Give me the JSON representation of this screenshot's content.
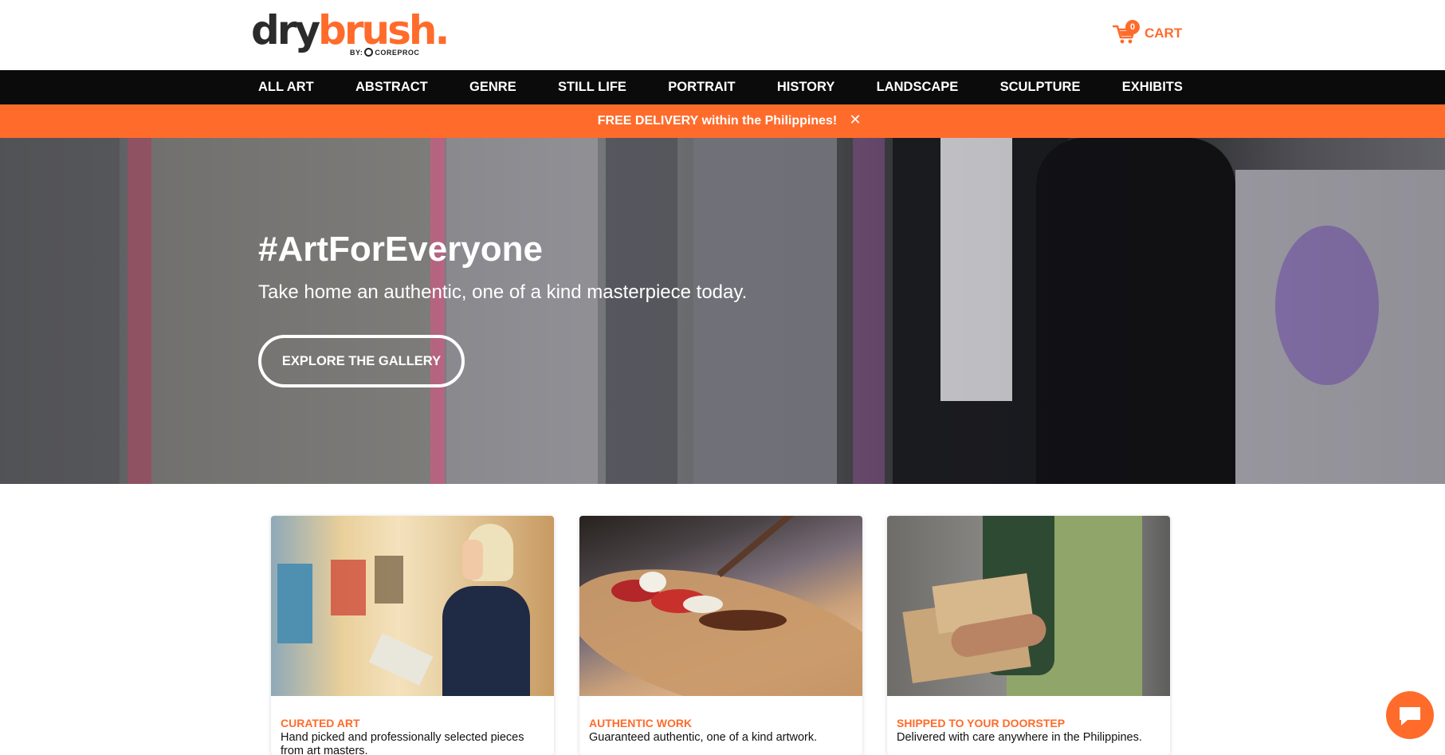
{
  "brand": {
    "logo_dry": "dry",
    "logo_brush": "brush.",
    "logo_by": "BY:",
    "logo_company": "COREPROC",
    "accent_color": "#ff6b2b"
  },
  "cart": {
    "count": "0",
    "label": "CART",
    "icon": "cart-icon"
  },
  "nav": {
    "items": [
      {
        "label": "ALL ART"
      },
      {
        "label": "ABSTRACT"
      },
      {
        "label": "GENRE"
      },
      {
        "label": "STILL LIFE"
      },
      {
        "label": "PORTRAIT"
      },
      {
        "label": "HISTORY"
      },
      {
        "label": "LANDSCAPE"
      },
      {
        "label": "SCULPTURE"
      },
      {
        "label": "EXHIBITS"
      }
    ]
  },
  "promo": {
    "text": "FREE DELIVERY within the Philippines!",
    "close_glyph": "✕"
  },
  "hero": {
    "title": "#ArtForEveryone",
    "subtitle": "Take home an authentic, one of a kind masterpiece today.",
    "cta_label": "EXPLORE THE GALLERY"
  },
  "features": [
    {
      "title": "CURATED ART",
      "description": "Hand picked and professionally selected pieces from art masters."
    },
    {
      "title": "AUTHENTIC WORK",
      "description": "Guaranteed authentic, one of a kind artwork."
    },
    {
      "title": "SHIPPED TO YOUR DOORSTEP",
      "description": "Delivered with care anywhere in the Philippines."
    }
  ],
  "chat": {
    "icon": "chat-icon"
  }
}
